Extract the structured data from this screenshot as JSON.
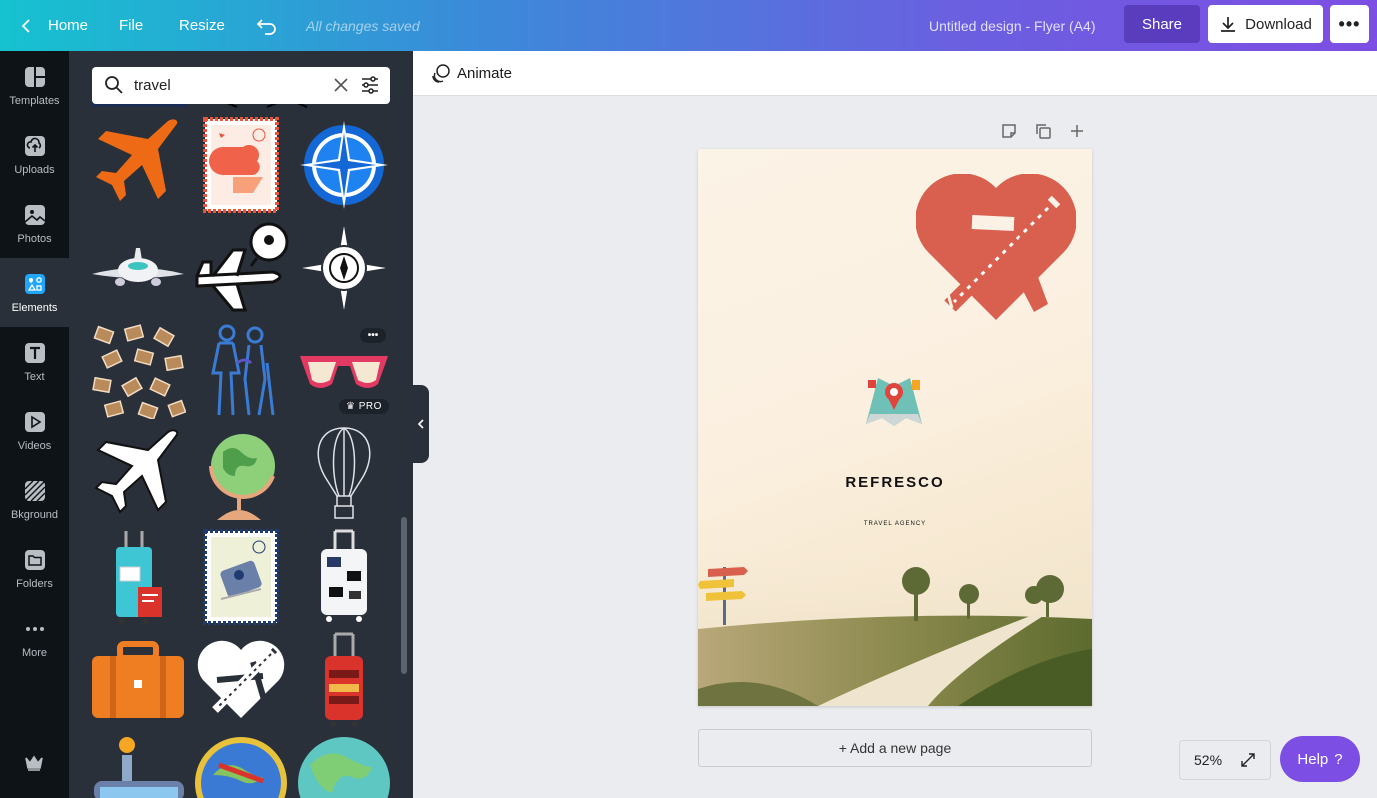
{
  "topbar": {
    "home_label": "Home",
    "file_label": "File",
    "resize_label": "Resize",
    "save_status": "All changes saved",
    "design_title": "Untitled design - Flyer (A4)",
    "share_label": "Share",
    "download_label": "Download",
    "more_label": "•••"
  },
  "rail": {
    "items": [
      {
        "label": "Templates",
        "icon": "templates-icon"
      },
      {
        "label": "Uploads",
        "icon": "upload-icon"
      },
      {
        "label": "Photos",
        "icon": "photo-icon"
      },
      {
        "label": "Elements",
        "icon": "elements-icon",
        "active": true
      },
      {
        "label": "Text",
        "icon": "text-icon"
      },
      {
        "label": "Videos",
        "icon": "video-icon"
      },
      {
        "label": "Bkground",
        "icon": "background-icon"
      },
      {
        "label": "Folders",
        "icon": "folder-icon"
      },
      {
        "label": "More",
        "icon": "more-icon"
      }
    ]
  },
  "panel": {
    "search_value": "travel",
    "pro_label": "PRO",
    "dots_label": "•••"
  },
  "editor": {
    "animate_label": "Animate",
    "brand_text": "REFRESCO",
    "tagline_text": "TRAVEL AGENCY",
    "add_page_label": "+ Add a new page",
    "zoom_level": "52%",
    "help_label": "Help",
    "help_mark": "?"
  },
  "colors": {
    "accent": "#7d4ee3",
    "heart_red": "#d9604f",
    "rail_bg": "#0e1318",
    "panel_bg": "#293039",
    "elements_active": "#1ea7fd"
  }
}
